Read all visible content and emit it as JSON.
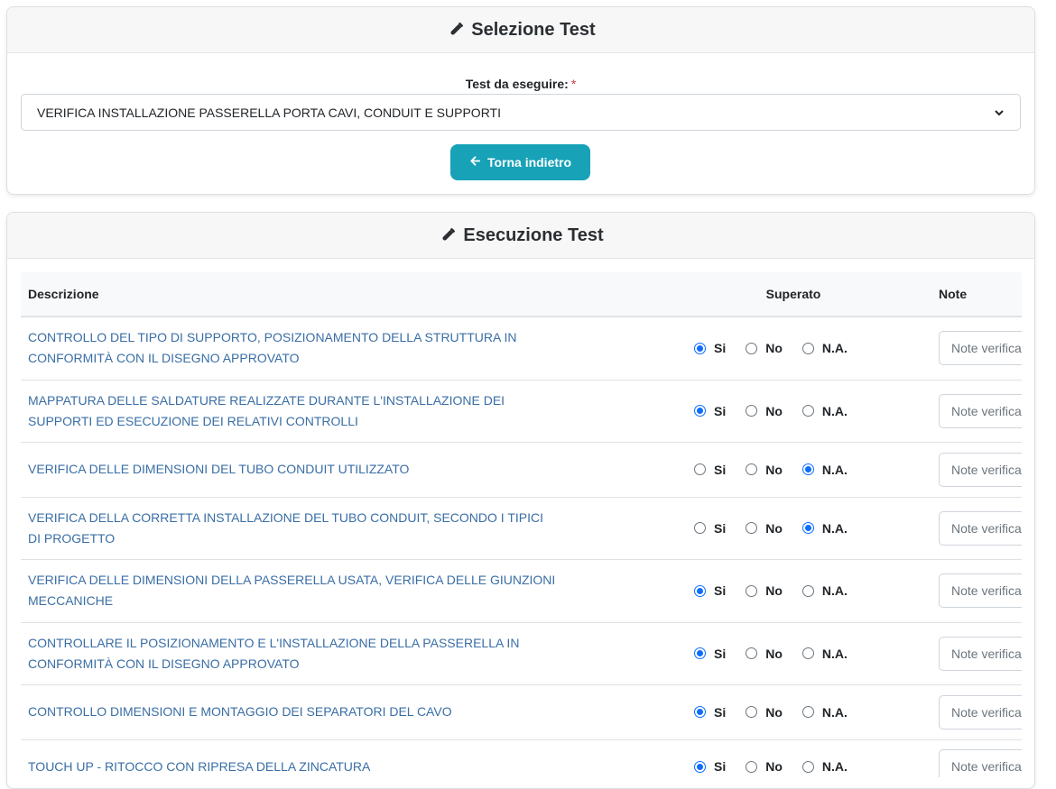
{
  "selection": {
    "title": "Selezione Test",
    "label": "Test da eseguire:",
    "required_mark": "*",
    "selected_test": "VERIFICA INSTALLAZIONE PASSERELLA PORTA CAVI, CONDUIT E SUPPORTI",
    "back_button": "Torna indietro"
  },
  "execution": {
    "title": "Esecuzione Test",
    "columns": {
      "description": "Descrizione",
      "passed": "Superato",
      "notes": "Note"
    },
    "options": {
      "yes": "Si",
      "no": "No",
      "na": "N.A."
    },
    "note_placeholder": "Note verifica",
    "rows": [
      {
        "description": "CONTROLLO DEL TIPO DI SUPPORTO, POSIZIONAMENTO DELLA STRUTTURA IN CONFORMITÀ CON IL DISEGNO APPROVATO",
        "selected": "yes"
      },
      {
        "description": "MAPPATURA DELLE SALDATURE REALIZZATE DURANTE L'INSTALLAZIONE DEI SUPPORTI ED ESECUZIONE DEI RELATIVI CONTROLLI",
        "selected": "yes"
      },
      {
        "description": "VERIFICA DELLE DIMENSIONI DEL TUBO CONDUIT UTILIZZATO",
        "selected": "na"
      },
      {
        "description": "VERIFICA DELLA CORRETTA INSTALLAZIONE DEL TUBO CONDUIT, SECONDO I TIPICI DI PROGETTO",
        "selected": "na"
      },
      {
        "description": "VERIFICA DELLE DIMENSIONI DELLA PASSERELLA USATA, VERIFICA DELLE GIUNZIONI MECCANICHE",
        "selected": "yes"
      },
      {
        "description": "CONTROLLARE IL POSIZIONAMENTO E L'INSTALLAZIONE DELLA PASSERELLA IN CONFORMITÀ CON IL DISEGNO APPROVATO",
        "selected": "yes"
      },
      {
        "description": "CONTROLLO DIMENSIONI E MONTAGGIO DEI SEPARATORI DEL CAVO",
        "selected": "yes"
      },
      {
        "description": "TOUCH UP - RITOCCO CON RIPRESA DELLA ZINCATURA",
        "selected": "yes"
      }
    ]
  },
  "colors": {
    "accent": "#17a2b8",
    "link_text": "#3a6ea5",
    "radio_checked": "#0d6efd",
    "required": "#dc3545"
  },
  "icons": {
    "header": "test-tube-icon",
    "back": "arrow-left-icon",
    "select": "chevron-down-icon"
  }
}
